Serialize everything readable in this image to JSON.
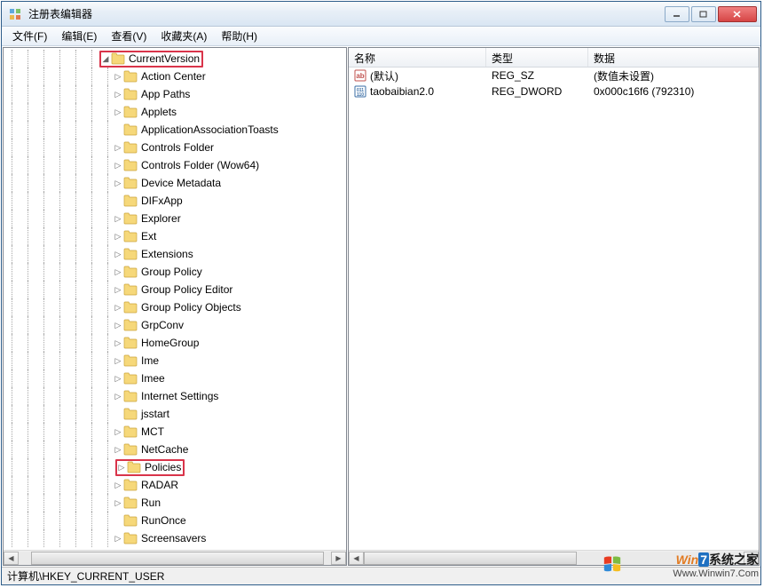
{
  "window": {
    "title": "注册表编辑器"
  },
  "menu": {
    "file": "文件(F)",
    "edit": "编辑(E)",
    "view": "查看(V)",
    "favorites": "收藏夹(A)",
    "help": "帮助(H)"
  },
  "tree": {
    "root": "CurrentVersion",
    "items": [
      "Action Center",
      "App Paths",
      "Applets",
      "ApplicationAssociationToasts",
      "Controls Folder",
      "Controls Folder (Wow64)",
      "Device Metadata",
      "DIFxApp",
      "Explorer",
      "Ext",
      "Extensions",
      "Group Policy",
      "Group Policy Editor",
      "Group Policy Objects",
      "GrpConv",
      "HomeGroup",
      "Ime",
      "Imee",
      "Internet Settings",
      "jsstart",
      "MCT",
      "NetCache",
      "Policies",
      "RADAR",
      "Run",
      "RunOnce",
      "Screensavers"
    ],
    "highlight_indices": [
      22
    ],
    "no_expander_indices": [
      3,
      7,
      19,
      25
    ]
  },
  "list": {
    "columns": {
      "name": "名称",
      "type": "类型",
      "data": "数据"
    },
    "rows": [
      {
        "icon": "string",
        "name": "(默认)",
        "type": "REG_SZ",
        "data": "(数值未设置)"
      },
      {
        "icon": "binary",
        "name": "taobaibian2.0",
        "type": "REG_DWORD",
        "data": "0x000c16f6 (792310)"
      }
    ]
  },
  "statusbar": "计算机\\HKEY_CURRENT_USER",
  "watermark": {
    "line1_brand_w": "W",
    "line1_brand_in": "in",
    "line1_brand_7": "7",
    "line1_rest": "系统之家",
    "line2": "Www.Winwin7.Com"
  }
}
